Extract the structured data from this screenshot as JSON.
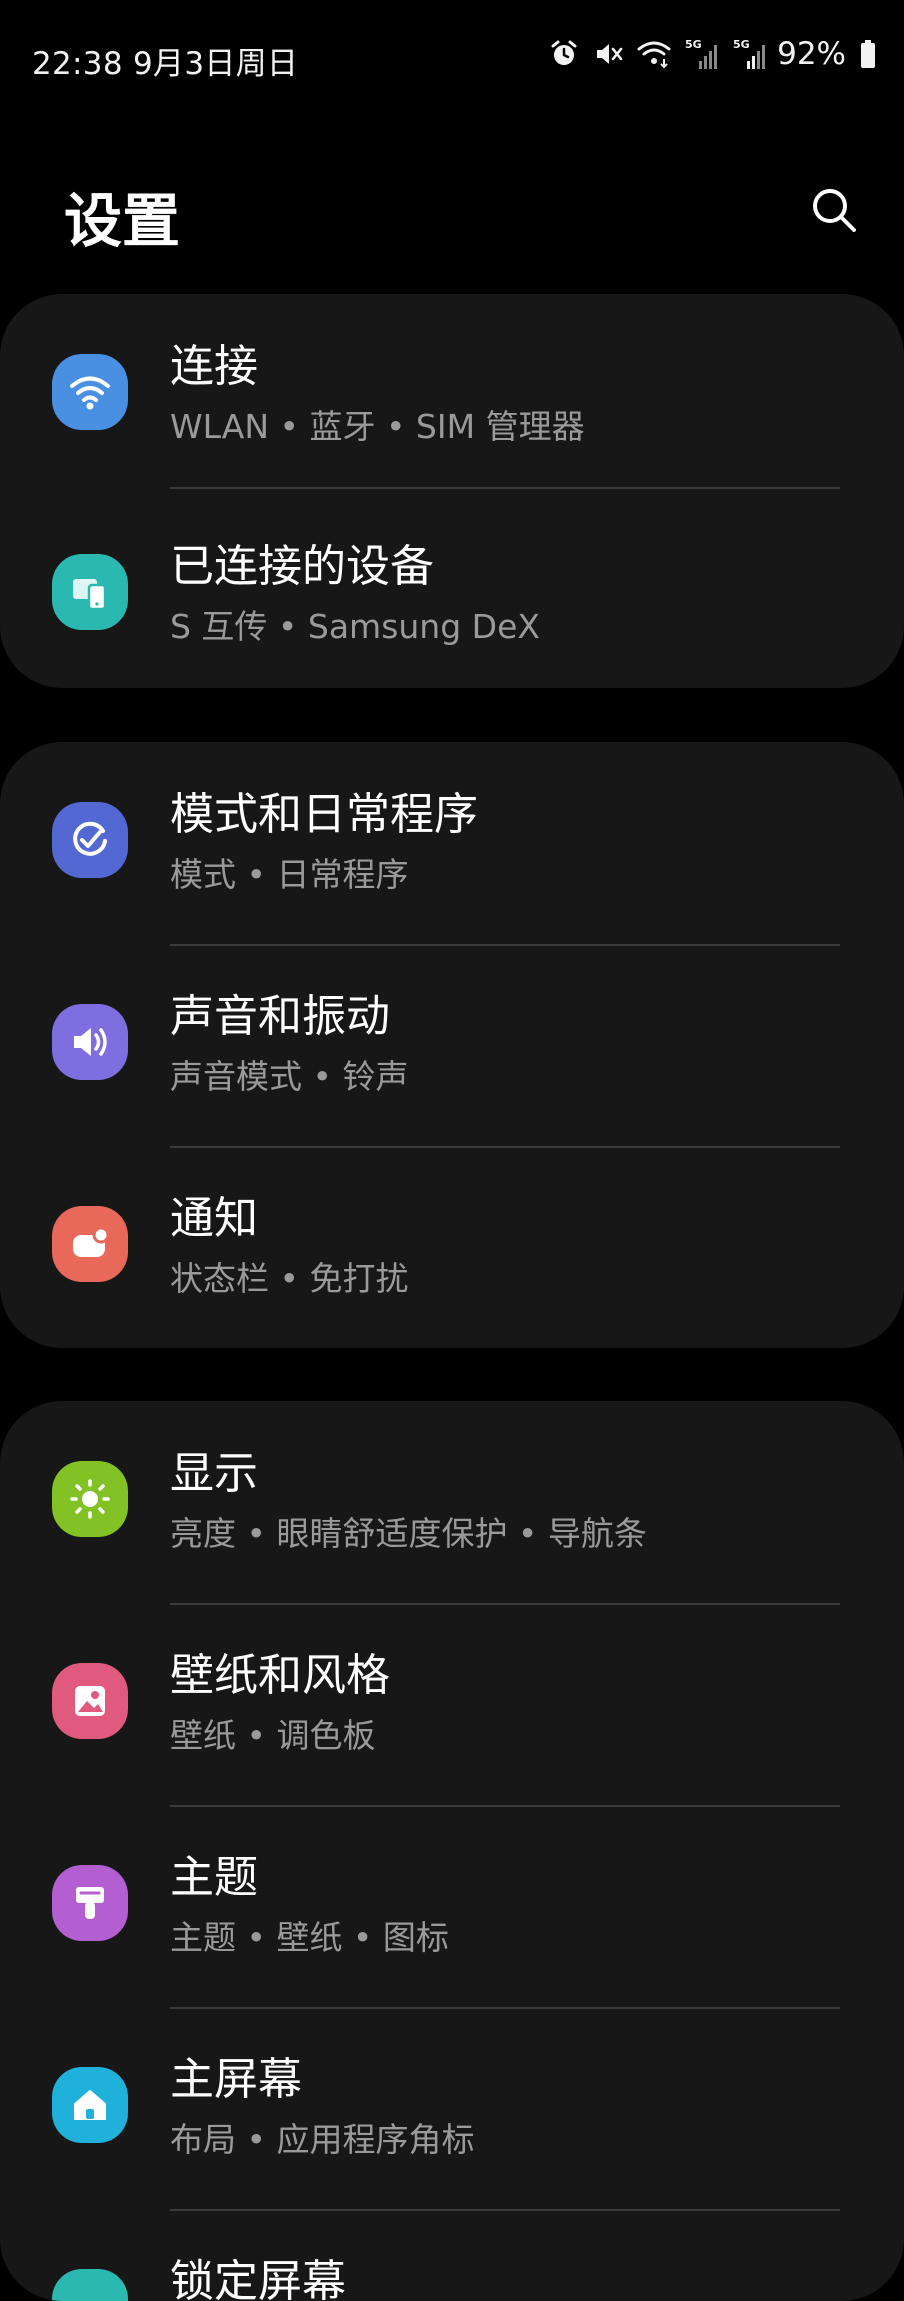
{
  "status_bar": {
    "time_date": "22:38   9月3日周日",
    "battery": "92%",
    "network_labels": [
      "5G",
      "5G"
    ]
  },
  "header": {
    "title": "设置"
  },
  "settings": [
    {
      "group": 1,
      "items": [
        {
          "title": "连接",
          "subtitle": "WLAN  •  蓝牙  •  SIM 管理器",
          "icon": "wifi-icon",
          "color": "#4a90e2"
        },
        {
          "title": "已连接的设备",
          "subtitle": "S 互传  •  Samsung DeX",
          "icon": "connected-devices-icon",
          "color": "#2bb8b0"
        }
      ]
    },
    {
      "group": 2,
      "items": [
        {
          "title": "模式和日常程序",
          "subtitle": "模式  •  日常程序",
          "icon": "modes-routines-icon",
          "color": "#5468d4"
        },
        {
          "title": "声音和振动",
          "subtitle": "声音模式  •  铃声",
          "icon": "speaker-icon",
          "color": "#7e6ee0"
        },
        {
          "title": "通知",
          "subtitle": "状态栏  •  免打扰",
          "icon": "notification-icon",
          "color": "#e8695a"
        }
      ]
    },
    {
      "group": 3,
      "items": [
        {
          "title": "显示",
          "subtitle": "亮度  •  眼睛舒适度保护  •  导航条",
          "icon": "sun-icon",
          "color": "#82c224"
        },
        {
          "title": "壁纸和风格",
          "subtitle": "壁纸  •  调色板",
          "icon": "wallpaper-icon",
          "color": "#e05a7e"
        },
        {
          "title": "主题",
          "subtitle": "主题  •  壁纸  •  图标",
          "icon": "paintbrush-icon",
          "color": "#b35fd1"
        },
        {
          "title": "主屏幕",
          "subtitle": "布局  •  应用程序角标",
          "icon": "home-icon",
          "color": "#1fb1d9"
        },
        {
          "title": "锁定屏幕",
          "subtitle": "",
          "icon": "lock-icon",
          "color": "#2bb8b0"
        }
      ]
    }
  ]
}
